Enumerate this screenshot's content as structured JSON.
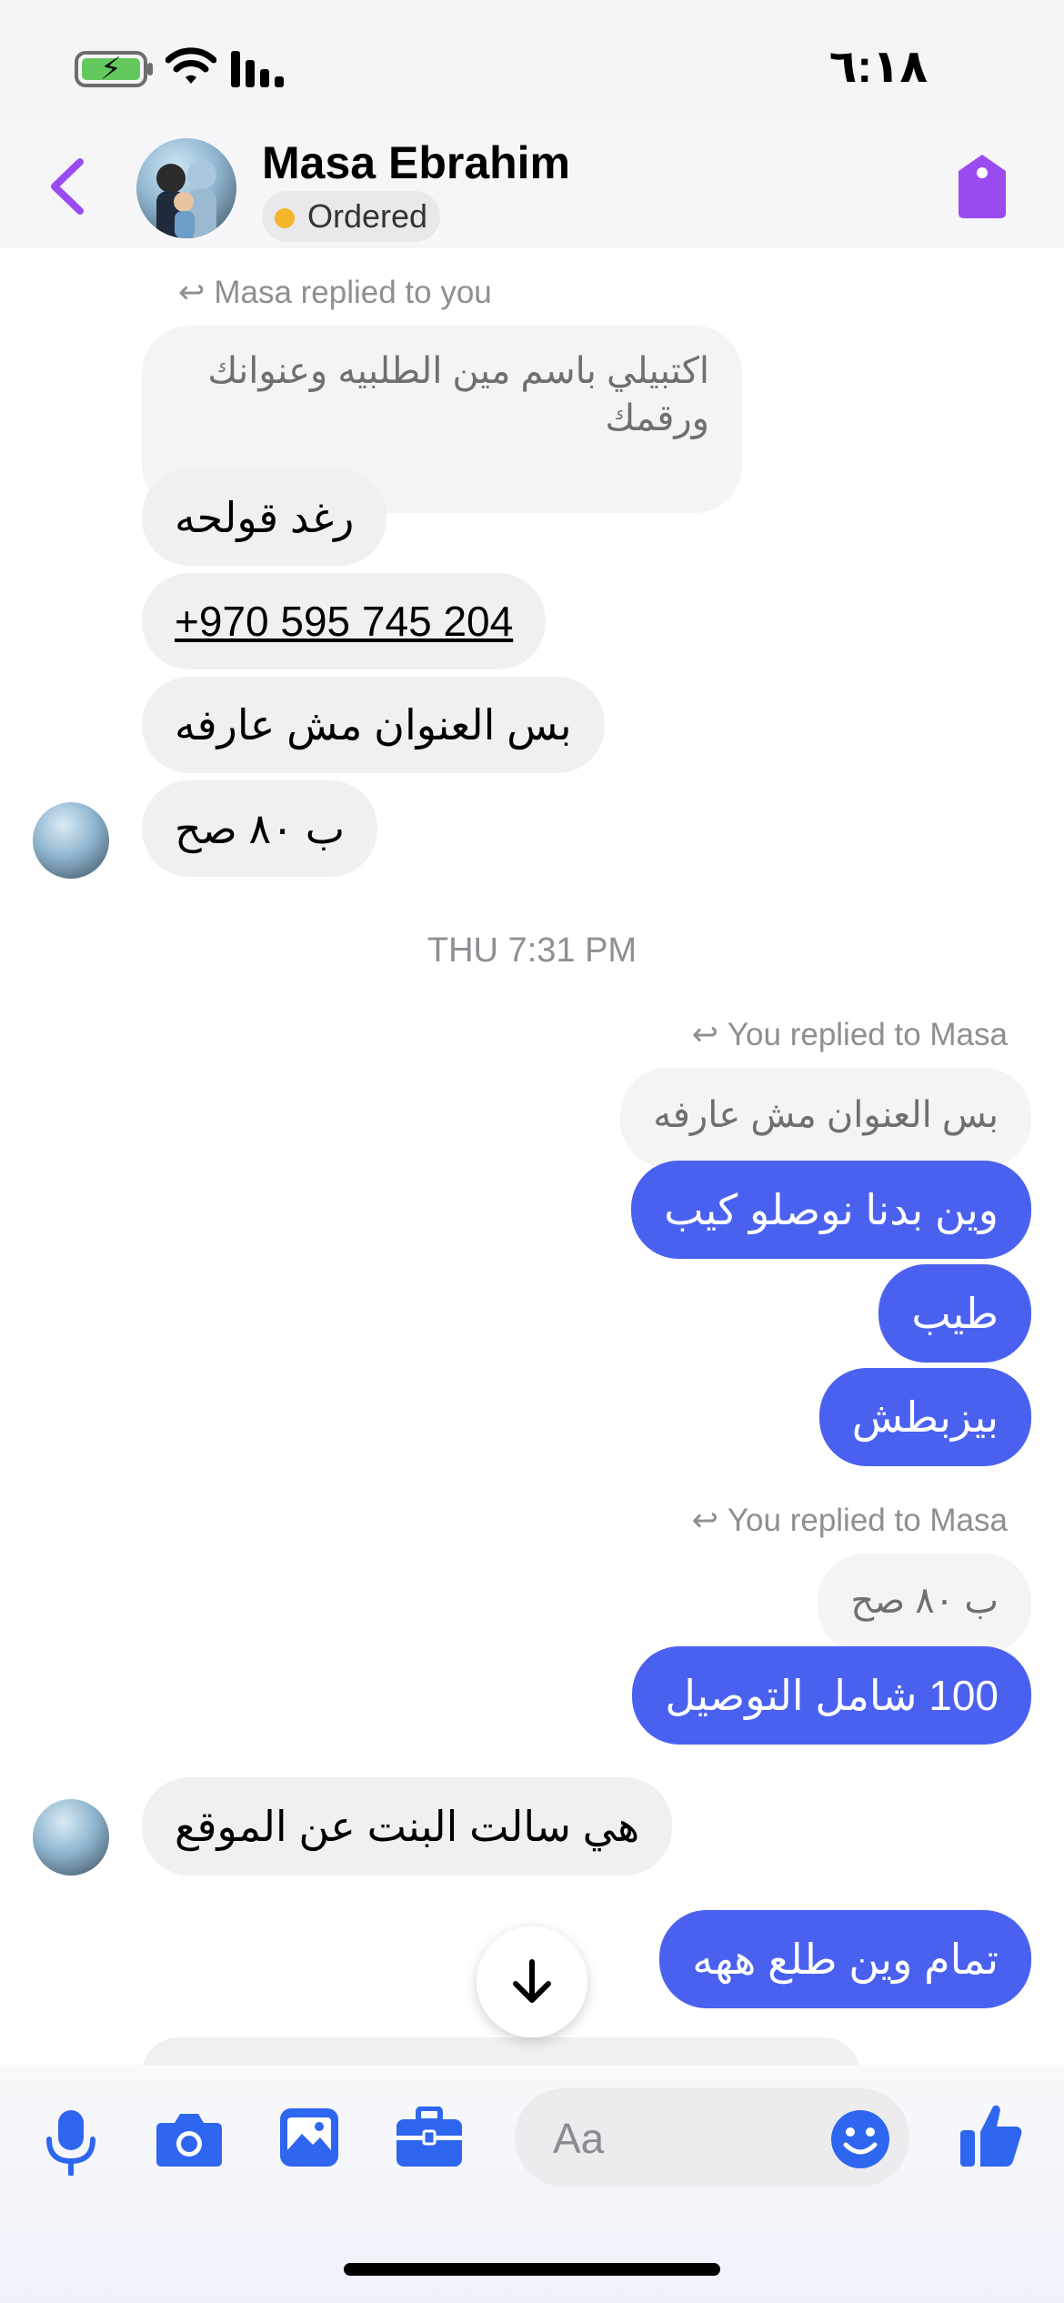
{
  "status_bar": {
    "time": "٦:١٨"
  },
  "header": {
    "contact_name": "Masa Ebrahim",
    "status": "Ordered",
    "accent_color": "#9a4bf0",
    "status_dot_color": "#f5b52b",
    "tag_icon": "label-tag-icon"
  },
  "thread": {
    "reply_note_1": "Masa replied to you",
    "quoted_1": "اكتبيلي باسم مين الطلبيه وعنوانك ورقمك",
    "msg_in_1": "رغد قولحه",
    "msg_in_2": "+970 595 745 204",
    "msg_in_3": "بس العنوان مش عارفه",
    "msg_in_4": "ب ٨٠ صح",
    "timestamp": "THU 7:31 PM",
    "reply_note_2": "You replied to Masa",
    "quoted_2": "بس العنوان مش عارفه",
    "msg_out_1": "وين بدنا نوصلو كيب",
    "msg_out_2": "طيب",
    "msg_out_3": "بيزبطش",
    "reply_note_3": "You replied to Masa",
    "quoted_3": "ب ٨٠ صح",
    "msg_out_4": "100 شامل التوصيل",
    "msg_in_5": "هي سالت البنت عن الموقع",
    "msg_out_5": "تمام وين طلع ههه"
  },
  "composer": {
    "placeholder": "Aa",
    "icons": [
      "microphone-icon",
      "camera-icon",
      "photo-icon",
      "briefcase-icon",
      "emoji-icon",
      "thumbs-up-icon"
    ],
    "accent_color": "#2f66f0"
  },
  "colors": {
    "outgoing_bubble": "#4a61f0",
    "incoming_bubble": "#f0f0f0"
  }
}
